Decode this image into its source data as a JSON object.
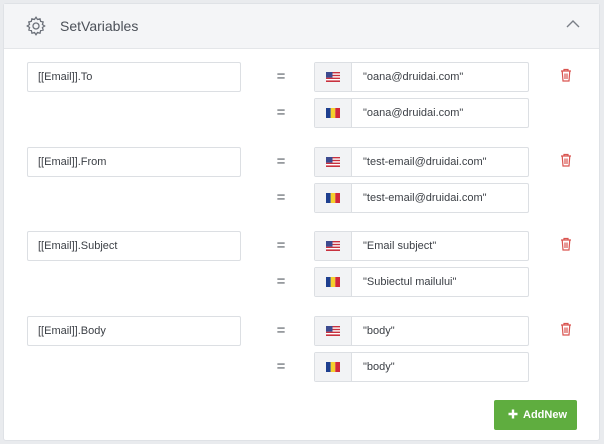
{
  "header": {
    "title": "SetVariables",
    "settings_icon": "gear-icon",
    "collapse_icon": "chevron-up-icon"
  },
  "variables": [
    {
      "name": "[[Email]].To",
      "operator": "=",
      "values": [
        {
          "locale_icon": "us-flag-icon",
          "text": "\"oana@druidai.com\""
        },
        {
          "locale_icon": "ro-flag-icon",
          "text": "\"oana@druidai.com\""
        }
      ]
    },
    {
      "name": "[[Email]].From",
      "operator": "=",
      "values": [
        {
          "locale_icon": "us-flag-icon",
          "text": "\"test-email@druidai.com\""
        },
        {
          "locale_icon": "ro-flag-icon",
          "text": "\"test-email@druidai.com\""
        }
      ]
    },
    {
      "name": "[[Email]].Subject",
      "operator": "=",
      "values": [
        {
          "locale_icon": "us-flag-icon",
          "text": "\"Email subject\""
        },
        {
          "locale_icon": "ro-flag-icon",
          "text": "\"Subiectul mailului\""
        }
      ]
    },
    {
      "name": "[[Email]].Body",
      "operator": "=",
      "values": [
        {
          "locale_icon": "us-flag-icon",
          "text": "\"body\""
        },
        {
          "locale_icon": "ro-flag-icon",
          "text": "\"body\""
        }
      ]
    }
  ],
  "actions": {
    "add_label": "AddNew",
    "add_icon": "plus-icon",
    "delete_icon": "trash-icon"
  },
  "colors": {
    "accent_green": "#5fad3f",
    "delete_red": "#d9534f"
  }
}
